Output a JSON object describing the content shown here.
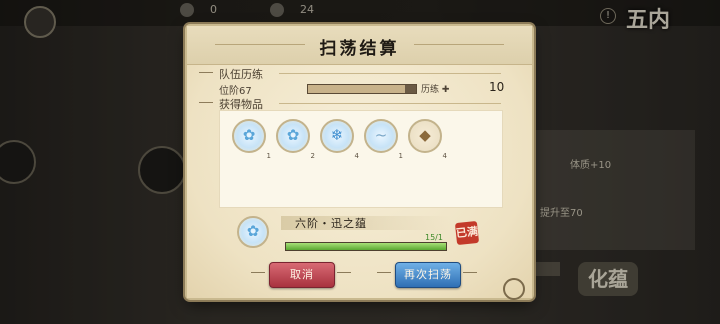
{
  "top_resources": [
    {
      "icon": "feather-icon",
      "value": "0"
    },
    {
      "icon": "gem-icon",
      "value": "24"
    }
  ],
  "stage_label": "五内",
  "side_panel": {
    "bonus_text": "体质+10",
    "upgrade_text": "提升至70",
    "huacheng_label": "化蕴"
  },
  "dialog": {
    "title": "扫荡结算",
    "team_section": "队伍历练",
    "rank_text": "位阶67",
    "exp_fraction": 0.9,
    "exp_label": "历练 ✚",
    "exp_value": "10",
    "items_section": "获得物品",
    "items": [
      {
        "icon": "blue-orb-icon",
        "count": "1"
      },
      {
        "icon": "blue-orb-icon",
        "count": "2"
      },
      {
        "icon": "wind-crystal-icon",
        "count": "4"
      },
      {
        "icon": "spirit-feather-icon",
        "count": "1"
      },
      {
        "icon": "golden-pill-icon",
        "count": "4"
      }
    ],
    "obtained": {
      "name": "六阶・迅之蕴",
      "count": "15/1",
      "fraction": 1.0
    },
    "seal_text": "已满",
    "cancel_label": "取消",
    "again_label": "再次扫荡"
  },
  "colors": {
    "cancel": "#c14a55",
    "again": "#3f80c4",
    "progress_green": "#6cbf3c"
  }
}
